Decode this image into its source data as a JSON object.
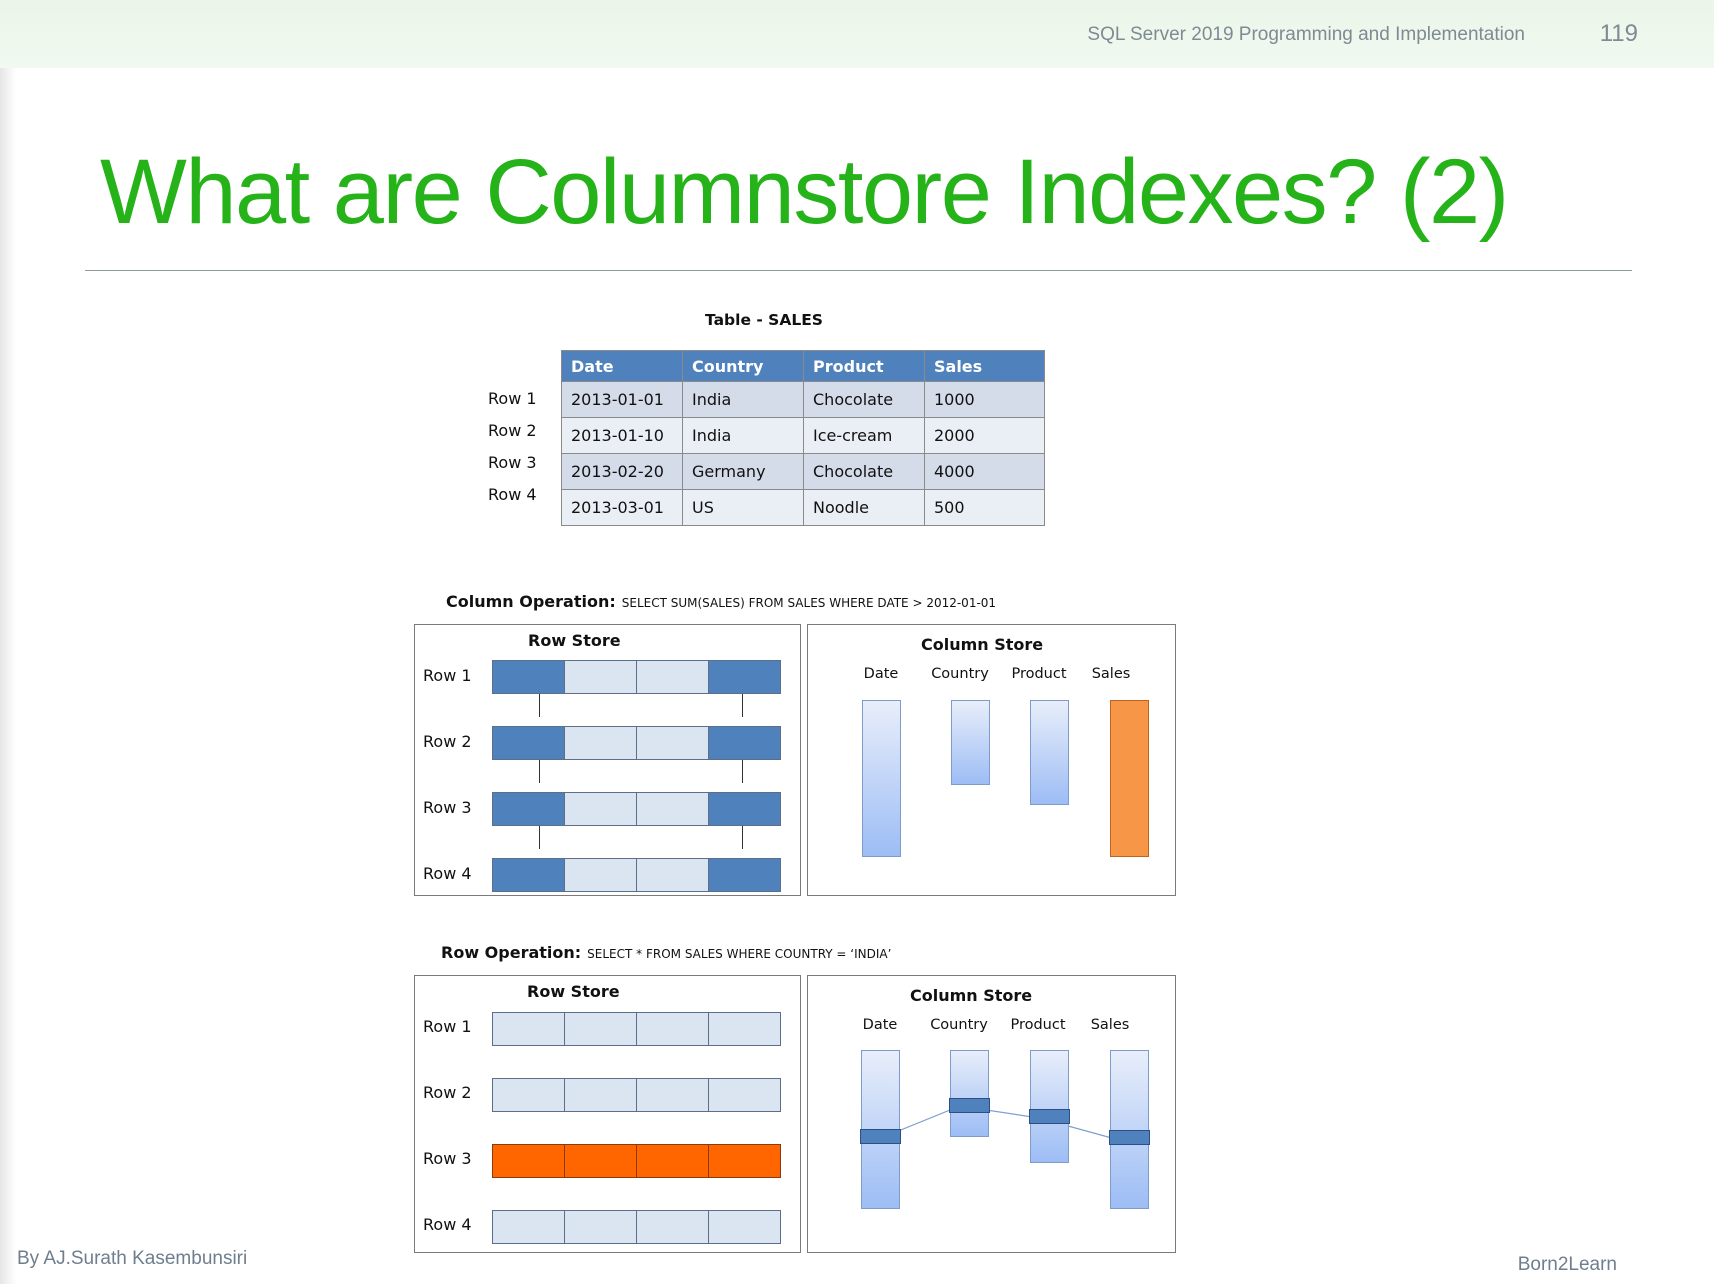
{
  "header": {
    "course_title": "SQL Server 2019 Programming and Implementation",
    "page_number": "119"
  },
  "slide_title": "What are Columnstore Indexes? (2)",
  "footer": {
    "author": "By AJ.Surath Kasembunsiri",
    "brand": "Born2Learn"
  },
  "sales_table": {
    "caption": "Table - SALES",
    "columns": [
      "Date",
      "Country",
      "Product",
      "Sales"
    ],
    "row_labels": [
      "Row 1",
      "Row 2",
      "Row 3",
      "Row 4"
    ],
    "rows": [
      [
        "2013-01-01",
        "India",
        "Chocolate",
        "1000"
      ],
      [
        "2013-01-10",
        "India",
        "Ice-cream",
        "2000"
      ],
      [
        "2013-02-20",
        "Germany",
        "Chocolate",
        "4000"
      ],
      [
        "2013-03-01",
        "US",
        "Noodle",
        "500"
      ]
    ]
  },
  "column_operation": {
    "label": "Column Operation:",
    "query": "SELECT SUM(SALES) FROM SALES WHERE DATE > 2012-01-01",
    "row_store": {
      "title": "Row Store",
      "row_labels": [
        "Row 1",
        "Row 2",
        "Row 3",
        "Row 4"
      ],
      "highlighted_columns": [
        0,
        3
      ]
    },
    "column_store": {
      "title": "Column Store",
      "columns": [
        "Date",
        "Country",
        "Product",
        "Sales"
      ],
      "highlighted_column": 3
    }
  },
  "row_operation": {
    "label": "Row Operation:",
    "query": "SELECT * FROM SALES WHERE COUNTRY = ‘INDIA’",
    "row_store": {
      "title": "Row Store",
      "row_labels": [
        "Row 1",
        "Row 2",
        "Row 3",
        "Row 4"
      ],
      "highlighted_row": 2
    },
    "column_store": {
      "title": "Column Store",
      "columns": [
        "Date",
        "Country",
        "Product",
        "Sales"
      ]
    }
  },
  "colors": {
    "title_green": "#25b319",
    "table_header_blue": "#4f81bd",
    "cell_light": "#dbe4f1",
    "highlight_orange": "#ff6600",
    "sales_orange": "#f79646"
  }
}
